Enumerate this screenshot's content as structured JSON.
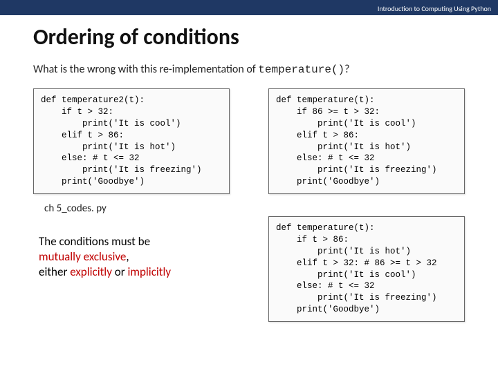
{
  "header": {
    "course": "Introduction to Computing Using Python"
  },
  "title": "Ordering of conditions",
  "question_prefix": "What is the wrong with this re-implementation of ",
  "question_mono": "temperature()",
  "question_suffix": "?",
  "code": {
    "left": "def temperature2(t):\n    if t > 32:\n        print('It is cool')\n    elif t > 86:\n        print('It is hot')\n    else: # t <= 32\n        print('It is freezing')\n    print('Goodbye')",
    "right_top": "def temperature(t):\n    if 86 >= t > 32:\n        print('It is cool')\n    elif t > 86:\n        print('It is hot')\n    else: # t <= 32\n        print('It is freezing')\n    print('Goodbye')",
    "right_bottom": "def temperature(t):\n    if t > 86:\n        print('It is hot')\n    elif t > 32: # 86 >= t > 32\n        print('It is cool')\n    else: # t <= 32\n        print('It is freezing')\n    print('Goodbye')"
  },
  "caption": "ch 5_codes. py",
  "explain": {
    "line1": "The conditions must be",
    "red1": "mutually exclusive",
    "mid": ",",
    "line2a": "either ",
    "red2": "explicitly",
    "line2b": " or ",
    "red3": "implicitly"
  }
}
